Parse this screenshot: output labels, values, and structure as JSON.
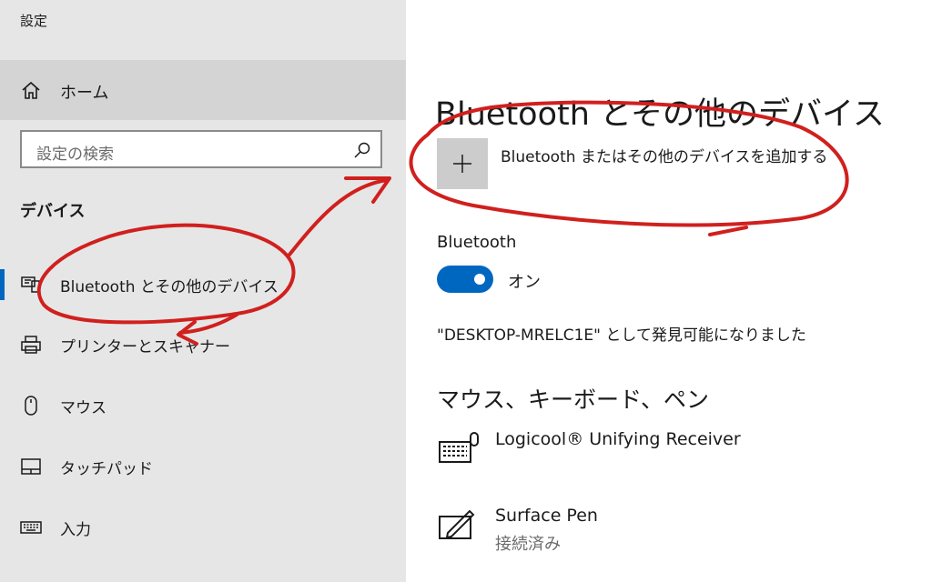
{
  "window": {
    "title": "設定"
  },
  "sidebar": {
    "home_label": "ホーム",
    "search_placeholder": "設定の検索",
    "section_heading": "デバイス",
    "items": [
      {
        "label": "Bluetooth とその他のデバイス",
        "icon": "bluetooth-devices-icon",
        "active": true
      },
      {
        "label": "プリンターとスキャナー",
        "icon": "printer-icon"
      },
      {
        "label": "マウス",
        "icon": "mouse-icon"
      },
      {
        "label": "タッチパッド",
        "icon": "touchpad-icon"
      },
      {
        "label": "入力",
        "icon": "keyboard-icon"
      }
    ]
  },
  "main": {
    "title": "Bluetooth とその他のデバイス",
    "add_device_label": "Bluetooth またはその他のデバイスを追加する",
    "bluetooth_label": "Bluetooth",
    "toggle_state": "オン",
    "discoverable_text": "\"DESKTOP-MRELC1E\" として発見可能になりました",
    "section_heading": "マウス、キーボード、ペン",
    "devices": [
      {
        "name": "Logicool® Unifying Receiver",
        "icon": "keyboard-mouse-icon",
        "status": ""
      },
      {
        "name": "Surface Pen",
        "icon": "pen-icon",
        "status": "接続済み"
      }
    ]
  },
  "colors": {
    "accent": "#0067c0",
    "annotation": "#d0201e",
    "sidebar_bg": "#e6e6e6"
  }
}
